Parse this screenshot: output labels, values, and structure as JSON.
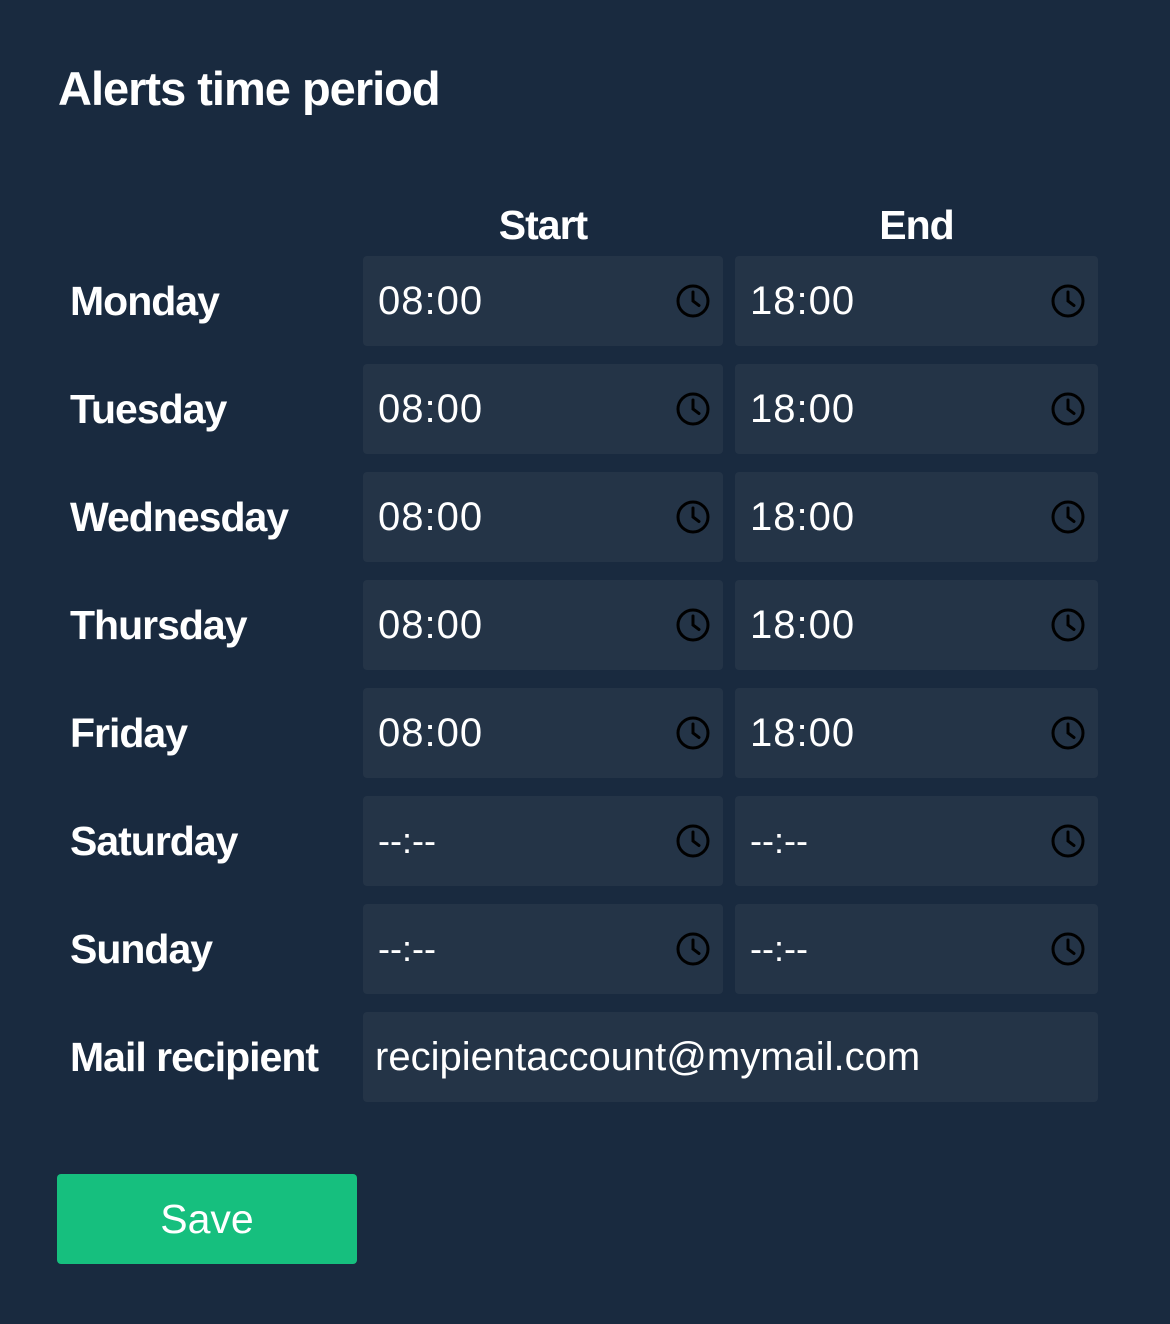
{
  "page": {
    "title": "Alerts time period"
  },
  "columns": {
    "start": "Start",
    "end": "End"
  },
  "days": [
    {
      "label": "Monday",
      "start": "08:00",
      "end": "18:00"
    },
    {
      "label": "Tuesday",
      "start": "08:00",
      "end": "18:00"
    },
    {
      "label": "Wednesday",
      "start": "08:00",
      "end": "18:00"
    },
    {
      "label": "Thursday",
      "start": "08:00",
      "end": "18:00"
    },
    {
      "label": "Friday",
      "start": "08:00",
      "end": "18:00"
    },
    {
      "label": "Saturday",
      "start": "--:--",
      "end": "--:--"
    },
    {
      "label": "Sunday",
      "start": "--:--",
      "end": "--:--"
    }
  ],
  "mail": {
    "label": "Mail recipient",
    "value": "recipientaccount@mymail.com"
  },
  "actions": {
    "save_label": "Save"
  },
  "colors": {
    "background": "#192a3f",
    "field_background": "#243447",
    "save_button": "#16bf7e",
    "text": "#ffffff",
    "icon": "#000000"
  },
  "icons": {
    "time_picker": "clock-icon"
  }
}
